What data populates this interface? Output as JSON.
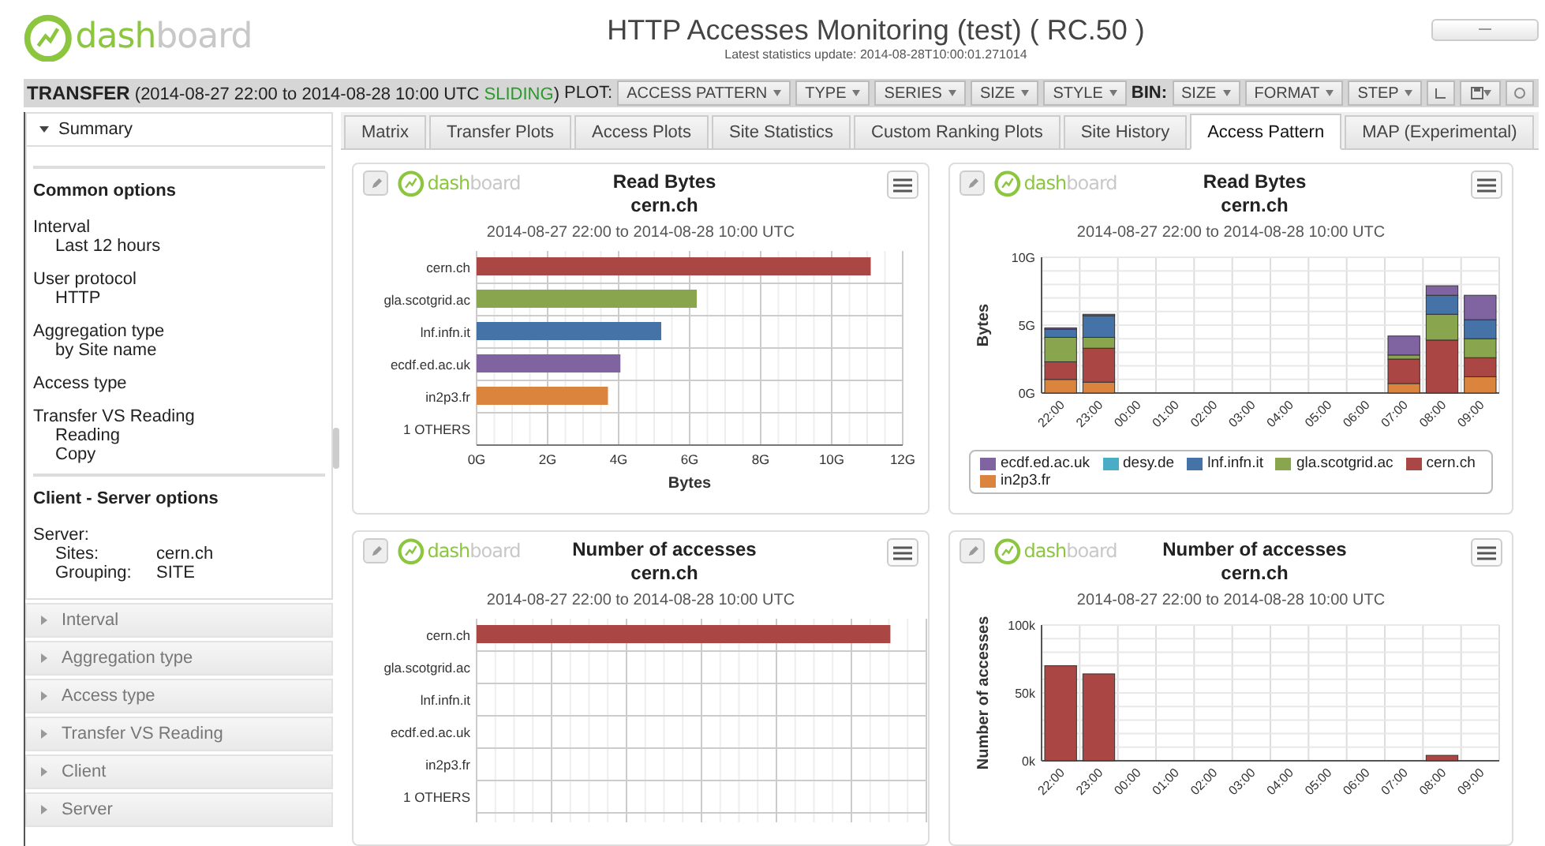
{
  "header": {
    "logo": {
      "part1": "dash",
      "part2": "board"
    },
    "title": "HTTP Accesses Monitoring (test) ( RC.50 )",
    "update": "Latest statistics update: 2014-08-28T10:00:01.271014"
  },
  "toolbar": {
    "mode": "TRANSFER",
    "range_open": "(2014-08-27 22:00 to 2014-08-28 10:00 UTC",
    "sliding": "SLIDING",
    "range_close": ")",
    "plot_label": "PLOT:",
    "plot_menus": [
      "ACCESS PATTERN",
      "TYPE",
      "SERIES",
      "SIZE",
      "STYLE"
    ],
    "bin_label": "BIN:",
    "bin_menus": [
      "SIZE",
      "FORMAT",
      "STEP"
    ]
  },
  "sidebar": {
    "summary": {
      "label": "Summary",
      "expanded": true
    },
    "sections": [
      {
        "heading": "Common options",
        "items": [
          {
            "label": "Interval",
            "values": [
              "Last 12 hours"
            ]
          },
          {
            "label": "User protocol",
            "values": [
              "HTTP"
            ]
          },
          {
            "label": "Aggregation type",
            "values": [
              "by Site name"
            ]
          },
          {
            "label": "Access type"
          },
          {
            "label": "Transfer VS Reading",
            "values": [
              "Reading",
              "Copy"
            ]
          }
        ]
      },
      {
        "heading": "Client - Server options",
        "items": [
          {
            "label": "Server:",
            "rows": [
              {
                "key": "Sites:",
                "value": "cern.ch"
              },
              {
                "key": "Grouping:",
                "value": "SITE"
              }
            ]
          }
        ]
      }
    ],
    "accordion": [
      {
        "label": "Interval",
        "expanded": false
      },
      {
        "label": "Aggregation type",
        "expanded": false
      },
      {
        "label": "Access type",
        "expanded": false
      },
      {
        "label": "Transfer VS Reading",
        "expanded": false
      },
      {
        "label": "Client",
        "expanded": false
      },
      {
        "label": "Server",
        "expanded": false
      }
    ]
  },
  "tabs": [
    {
      "label": "Matrix",
      "selected": false
    },
    {
      "label": "Transfer Plots",
      "selected": false
    },
    {
      "label": "Access Plots",
      "selected": false
    },
    {
      "label": "Site Statistics",
      "selected": false
    },
    {
      "label": "Custom Ranking Plots",
      "selected": false
    },
    {
      "label": "Site History",
      "selected": false
    },
    {
      "label": "Access Pattern",
      "selected": true
    },
    {
      "label": "MAP (Experimental)",
      "selected": false
    }
  ],
  "charts": [
    {
      "logo": {
        "part1": "dash",
        "part2": "board"
      },
      "title": "Read Bytes",
      "subtitle": "cern.ch",
      "range": "2014-08-27 22:00 to 2014-08-28 10:00 UTC",
      "chart_data": {
        "type": "bar",
        "orientation": "horizontal",
        "grid": true,
        "xlabel": "Bytes",
        "categories": [
          "cern.ch",
          "gla.scotgrid.ac",
          "lnf.infn.it",
          "ecdf.ed.ac.uk",
          "in2p3.fr",
          "1 OTHERS"
        ],
        "values": [
          11.1,
          6.2,
          5.2,
          4.05,
          3.7,
          0
        ],
        "colors": [
          "#aa4643",
          "#89a54e",
          "#4572a7",
          "#8064a2",
          "#db843d",
          "#cccccc"
        ],
        "xlim": [
          0,
          12
        ],
        "xticks": [
          {
            "value": 0,
            "label": "0G"
          },
          {
            "value": 2,
            "label": "2G"
          },
          {
            "value": 4,
            "label": "4G"
          },
          {
            "value": 6,
            "label": "6G"
          },
          {
            "value": 8,
            "label": "8G"
          },
          {
            "value": 10,
            "label": "10G"
          },
          {
            "value": 12,
            "label": "12G"
          }
        ]
      }
    },
    {
      "logo": {
        "part1": "dash",
        "part2": "board"
      },
      "title": "Read Bytes",
      "subtitle": "cern.ch",
      "range": "2014-08-27 22:00 to 2014-08-28 10:00 UTC",
      "chart_data": {
        "type": "bar",
        "orientation": "vertical",
        "grid": true,
        "stacked": true,
        "ylabel": "Bytes",
        "categories": [
          "22:00",
          "23:00",
          "00:00",
          "01:00",
          "02:00",
          "03:00",
          "04:00",
          "05:00",
          "06:00",
          "07:00",
          "08:00",
          "09:00"
        ],
        "ylim": [
          0,
          10
        ],
        "yticks": [
          {
            "value": 0,
            "label": "0G"
          },
          {
            "value": 5,
            "label": "5G"
          },
          {
            "value": 10,
            "label": "10G"
          }
        ],
        "series": [
          {
            "name": "ecdf.ed.ac.uk",
            "color": "#8064a2",
            "values": [
              0.1,
              0.1,
              0,
              0,
              0,
              0,
              0,
              0,
              0,
              1.4,
              0.7,
              1.8
            ]
          },
          {
            "name": "desy.de",
            "color": "#4bacc6",
            "values": [
              0,
              0,
              0,
              0,
              0,
              0,
              0,
              0,
              0,
              0,
              0,
              0
            ]
          },
          {
            "name": "lnf.infn.it",
            "color": "#4572a7",
            "values": [
              0.6,
              1.6,
              0,
              0,
              0,
              0,
              0,
              0,
              0,
              0,
              1.4,
              1.4
            ]
          },
          {
            "name": "gla.scotgrid.ac",
            "color": "#89a54e",
            "values": [
              1.8,
              0.8,
              0,
              0,
              0,
              0,
              0,
              0,
              0,
              0.3,
              1.9,
              1.4
            ]
          },
          {
            "name": "cern.ch",
            "color": "#aa4643",
            "values": [
              1.3,
              2.5,
              0,
              0,
              0,
              0,
              0,
              0,
              0,
              1.8,
              3.9,
              1.4
            ]
          },
          {
            "name": "in2p3.fr",
            "color": "#db843d",
            "values": [
              1.0,
              0.8,
              0,
              0,
              0,
              0,
              0,
              0,
              0,
              0.7,
              0,
              1.2
            ]
          }
        ]
      }
    },
    {
      "kind": "hbar_picture",
      "logo": {
        "part1": "dash",
        "part2": "board"
      },
      "title": "Number of accesses",
      "subtitle": "cern.ch",
      "range": "2014-08-27 22:00 to 2014-08-28 10:00 UTC",
      "row_labels": [
        "cern.ch",
        "gla.scotgrid.ac",
        "lnf.infn.it",
        "ecdf.ed.ac.uk",
        "in2p3.fr",
        "1 OTHERS"
      ]
    },
    {
      "logo": {
        "part1": "dash",
        "part2": "board"
      },
      "title": "Number of accesses",
      "subtitle": "cern.ch",
      "range": "2014-08-27 22:00 to 2014-08-28 10:00 UTC",
      "chart_data": {
        "type": "bar",
        "orientation": "vertical",
        "grid": true,
        "ylabel": "Number of accesses",
        "color": "#aa4643",
        "categories": [
          "22:00",
          "23:00",
          "00:00",
          "01:00",
          "02:00",
          "03:00",
          "04:00",
          "05:00",
          "06:00",
          "07:00",
          "08:00",
          "09:00"
        ],
        "ylim": [
          0,
          100
        ],
        "yticks": [
          {
            "value": 0,
            "label": "0k"
          },
          {
            "value": 50,
            "label": "50k"
          },
          {
            "value": 100,
            "label": "100k"
          }
        ],
        "values": [
          70,
          64,
          0,
          0,
          0,
          0,
          0,
          0,
          0,
          0,
          4,
          0
        ]
      }
    }
  ]
}
